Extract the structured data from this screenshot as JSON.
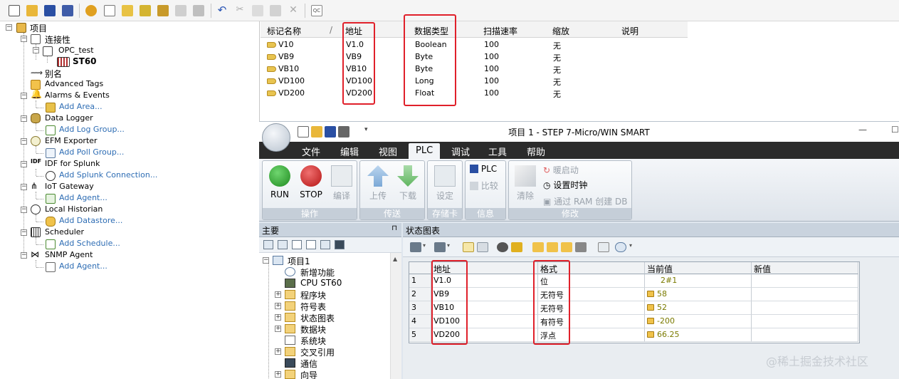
{
  "toolbar": {
    "icons": [
      "new-file-icon",
      "open-folder-icon",
      "save-icon",
      "save-as-icon",
      "settings-gear-icon",
      "table-icon",
      "add-folder-icon",
      "add-tag-icon",
      "add-item-icon",
      "add-item-disabled-icon",
      "print-icon",
      "undo-icon",
      "cut-icon",
      "copy-icon",
      "paste-icon",
      "delete-icon",
      "quick-client-icon"
    ]
  },
  "tree": {
    "project": "项目",
    "connectivity": "连接性",
    "opc_channel": "OPC_test",
    "device": "ST60",
    "aliases": "别名",
    "advanced_tags": "Advanced Tags",
    "alarms": "Alarms & Events",
    "alarms_add": "Add Area...",
    "data_logger": "Data Logger",
    "data_logger_add": "Add Log Group...",
    "efm": "EFM Exporter",
    "efm_add": "Add Poll Group...",
    "idf": "IDF for Splunk",
    "idf_add": "Add Splunk Connection...",
    "iot": "IoT Gateway",
    "iot_add": "Add Agent...",
    "historian": "Local Historian",
    "historian_add": "Add Datastore...",
    "scheduler": "Scheduler",
    "scheduler_add": "Add Schedule...",
    "snmp": "SNMP Agent",
    "snmp_add": "Add Agent..."
  },
  "tag_table": {
    "headers": [
      "标记名称",
      "/",
      "地址",
      "数据类型",
      "扫描速率",
      "缩放",
      "说明"
    ],
    "rows": [
      {
        "name": "V10",
        "address": "V1.0",
        "type": "Boolean",
        "rate": "100",
        "scale": "无",
        "desc": ""
      },
      {
        "name": "VB9",
        "address": "VB9",
        "type": "Byte",
        "rate": "100",
        "scale": "无",
        "desc": ""
      },
      {
        "name": "VB10",
        "address": "VB10",
        "type": "Byte",
        "rate": "100",
        "scale": "无",
        "desc": ""
      },
      {
        "name": "VD100",
        "address": "VD100",
        "type": "Long",
        "rate": "100",
        "scale": "无",
        "desc": ""
      },
      {
        "name": "VD200",
        "address": "VD200",
        "type": "Float",
        "rate": "100",
        "scale": "无",
        "desc": ""
      }
    ]
  },
  "step7": {
    "title": "项目 1 - STEP 7-Micro/WIN SMART",
    "menus": [
      "文件",
      "编辑",
      "视图",
      "PLC",
      "调试",
      "工具",
      "帮助"
    ],
    "active_menu": "PLC",
    "ribbon": {
      "run": "RUN",
      "stop": "STOP",
      "compile": "编译",
      "upload": "上传",
      "download": "下载",
      "setup": "设定",
      "plc": "PLC",
      "compare": "比较",
      "clear": "清除",
      "warm_start": "暖启动",
      "set_clock": "设置时钟",
      "create_db": "通过 RAM 创建 DB",
      "group_operate": "操作",
      "group_transfer": "传送",
      "group_memcard": "存储卡",
      "group_info": "信息",
      "group_modify": "修改"
    },
    "main_panel": {
      "title": "主要",
      "pin": "⊓",
      "items": [
        "项目1",
        "新增功能",
        "CPU ST60",
        "程序块",
        "符号表",
        "状态图表",
        "数据块",
        "系统块",
        "交叉引用",
        "通信",
        "向导"
      ]
    },
    "status_chart": {
      "title": "状态图表",
      "headers": [
        "",
        "地址",
        "格式",
        "当前值",
        "新值"
      ],
      "rows": [
        {
          "n": "1",
          "address": "V1.0",
          "format": "位",
          "value": "2#1",
          "locked": false,
          "new": ""
        },
        {
          "n": "2",
          "address": "VB9",
          "format": "无符号",
          "value": "58",
          "locked": true,
          "new": ""
        },
        {
          "n": "3",
          "address": "VB10",
          "format": "无符号",
          "value": "52",
          "locked": true,
          "new": ""
        },
        {
          "n": "4",
          "address": "VD100",
          "format": "有符号",
          "value": "-200",
          "locked": true,
          "new": ""
        },
        {
          "n": "5",
          "address": "VD200",
          "format": "浮点",
          "value": "66.25",
          "locked": true,
          "new": ""
        }
      ]
    }
  },
  "watermark": "@稀土掘金技术社区",
  "colors": {
    "highlight": "#e0202a",
    "link": "#2e6db4",
    "menubar": "#2b2b2b",
    "value": "#7a7a00"
  }
}
